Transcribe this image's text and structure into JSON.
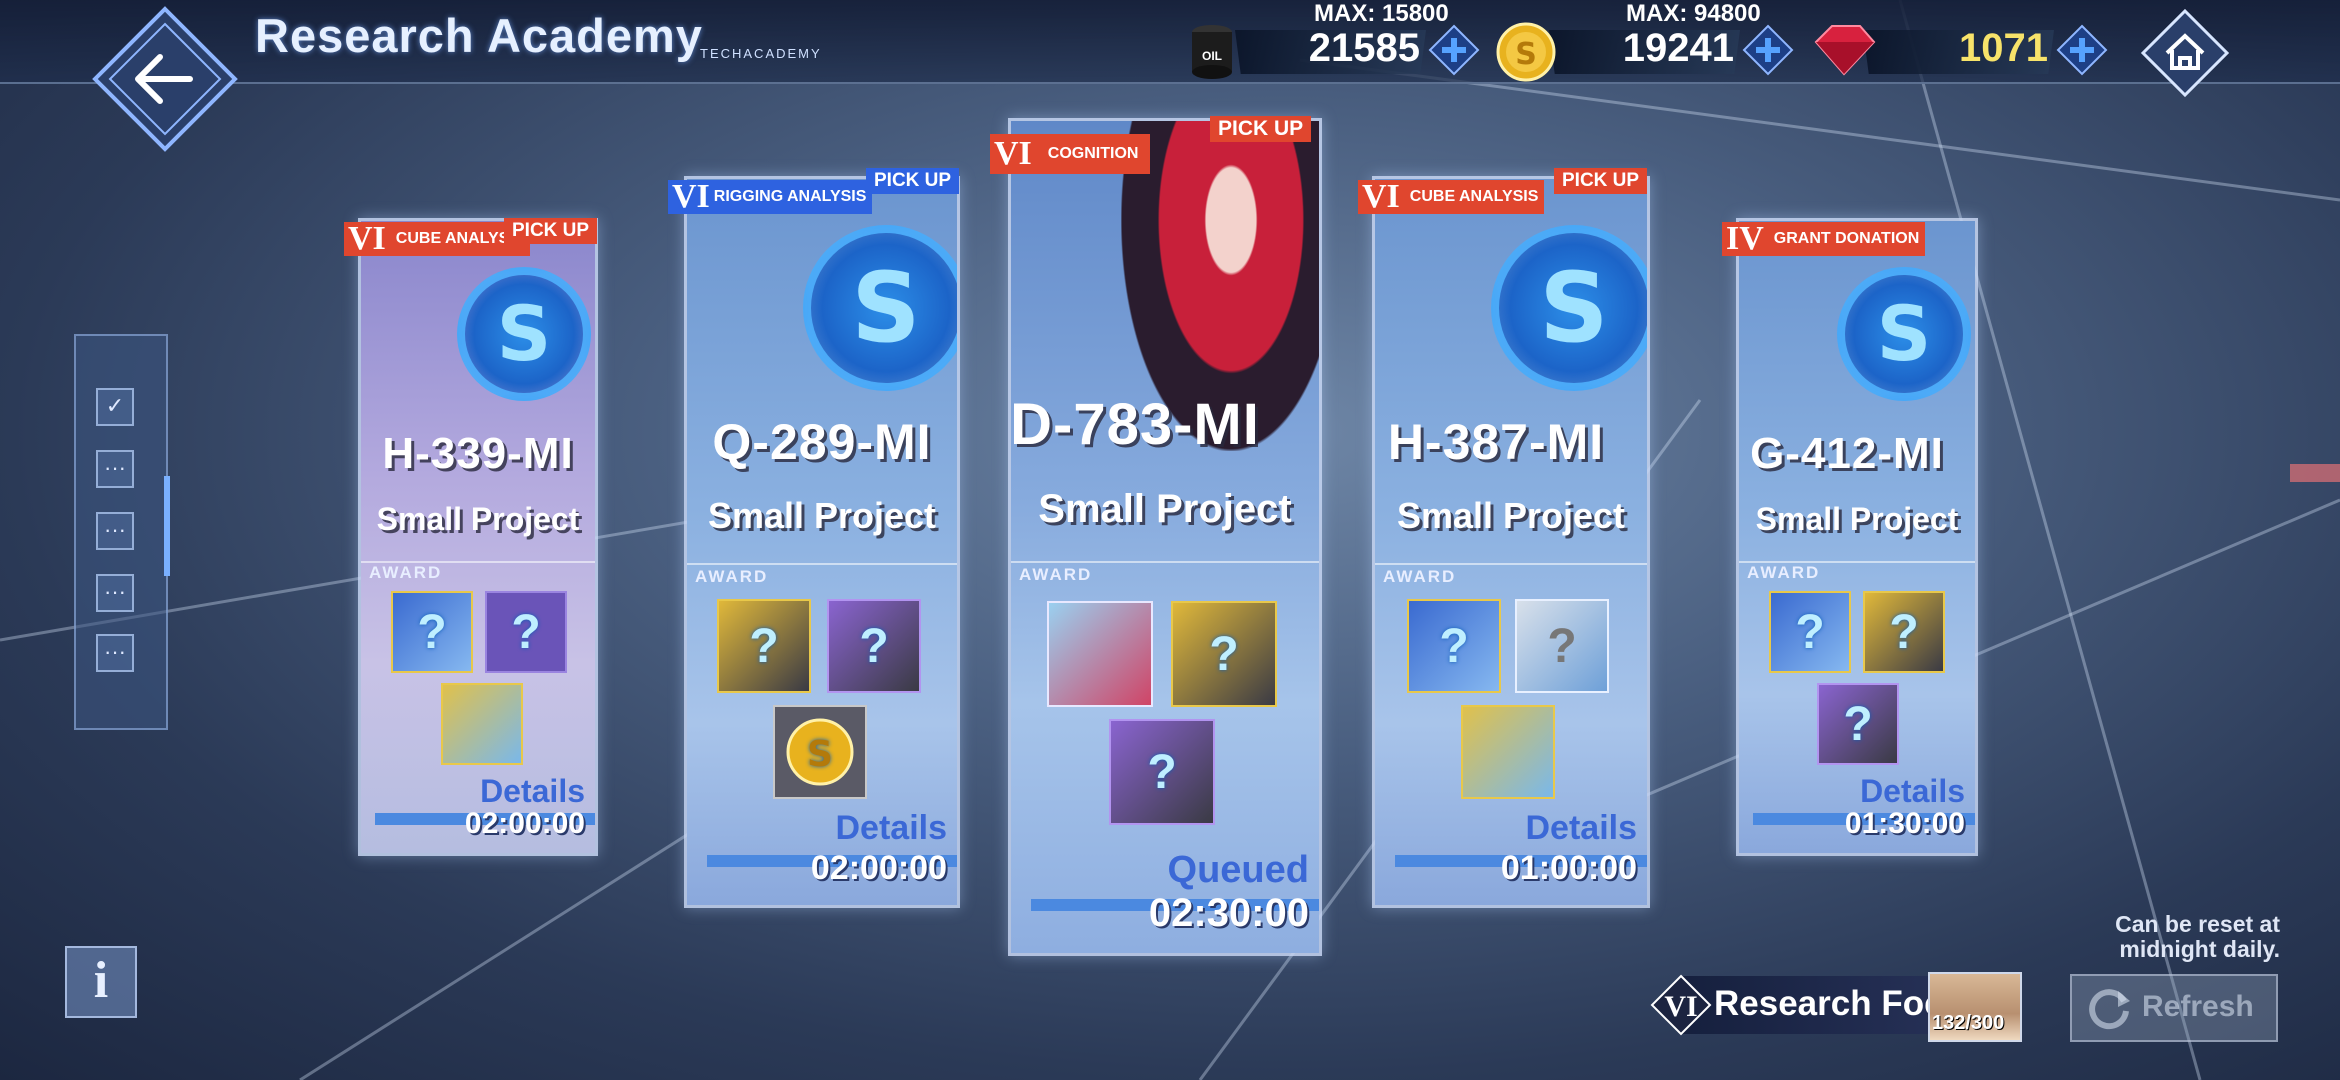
{
  "header": {
    "title": "Research Academy",
    "subtitle": "TECHACADEMY"
  },
  "resources": {
    "oil": {
      "max_label": "MAX: 15800",
      "value": "21585",
      "icon": "oil-barrel-icon",
      "icon_text": "OIL"
    },
    "coin": {
      "max_label": "MAX: 94800",
      "value": "19241",
      "icon": "gold-coin-icon"
    },
    "gem": {
      "value": "1071",
      "icon": "ruby-gem-icon"
    }
  },
  "cards": [
    {
      "rank": "VI",
      "category": "CUBE ANALYSIS",
      "pickup": "PICK UP",
      "code": "H-339-MI",
      "size": "Small Project",
      "award_label": "AWARD",
      "status": "Details",
      "time": "02:00:00"
    },
    {
      "rank": "VI",
      "category": "RIGGING ANALYSIS",
      "pickup": "PICK UP",
      "code": "Q-289-MI",
      "size": "Small Project",
      "award_label": "AWARD",
      "status": "Details",
      "time": "02:00:00"
    },
    {
      "rank": "VI",
      "category": "COGNITION",
      "pickup": "PICK UP",
      "code": "D-783-MI",
      "size": "Small Project",
      "award_label": "AWARD",
      "status": "Queued",
      "time": "02:30:00"
    },
    {
      "rank": "VI",
      "category": "CUBE ANALYSIS",
      "pickup": "PICK UP",
      "code": "H-387-MI",
      "size": "Small Project",
      "award_label": "AWARD",
      "status": "Details",
      "time": "01:00:00"
    },
    {
      "rank": "IV",
      "category": "GRANT DONATION",
      "pickup": "",
      "code": "G-412-MI",
      "size": "Small Project",
      "award_label": "AWARD",
      "status": "Details",
      "time": "01:30:00"
    }
  ],
  "award_glyph": "?",
  "filter": {
    "checked": "✓",
    "more": "···"
  },
  "info_label": "i",
  "reset_note_line1": "Can be reset at",
  "reset_note_line2": "midnight daily.",
  "refresh_label": "Refresh",
  "focus": {
    "rank": "VI",
    "label": "Research Focus",
    "count": "132/300"
  },
  "colors": {
    "accent": "#4b89e0",
    "tag_red": "#e0462e",
    "tag_blue": "#2e62e0",
    "status_blue": "#3b68d6"
  }
}
